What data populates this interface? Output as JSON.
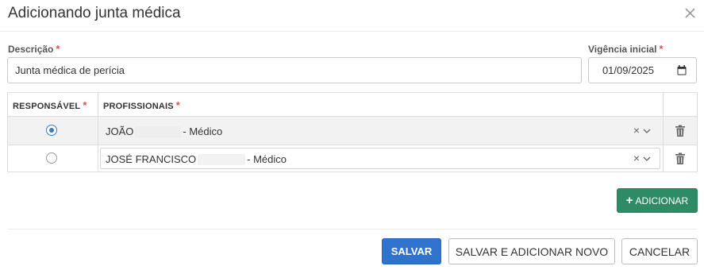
{
  "modal": {
    "title": "Adicionando junta médica",
    "close_icon": "close-icon"
  },
  "form": {
    "descricao": {
      "label": "Descrição",
      "required_mark": "*",
      "value": "Junta médica de perícia"
    },
    "vigencia": {
      "label": "Vigência inicial",
      "required_mark": "*",
      "value": "01/09/2025",
      "icon": "calendar-icon"
    }
  },
  "grid": {
    "headers": {
      "responsavel": {
        "label": "RESPONSÁVEL",
        "required_mark": "*"
      },
      "profissionais": {
        "label": "PROFISSIONAIS",
        "required_mark": "*"
      }
    },
    "rows": [
      {
        "responsavel_selected": true,
        "name_prefix": "JOÃO",
        "name_suffix": "- Médico",
        "clear_icon": "×"
      },
      {
        "responsavel_selected": false,
        "name_prefix": "JOSÉ FRANCISCO",
        "name_suffix": "- Médico",
        "clear_icon": "×"
      }
    ]
  },
  "buttons": {
    "add": {
      "plus": "+",
      "label": "ADICIONAR"
    },
    "save": "SALVAR",
    "save_new": "SALVAR E ADICIONAR NOVO",
    "cancel": "CANCELAR"
  },
  "colors": {
    "primary": "#2f73cf",
    "success": "#2e8b66",
    "required": "#d9534f",
    "radio_checked": "#3b78c6"
  }
}
